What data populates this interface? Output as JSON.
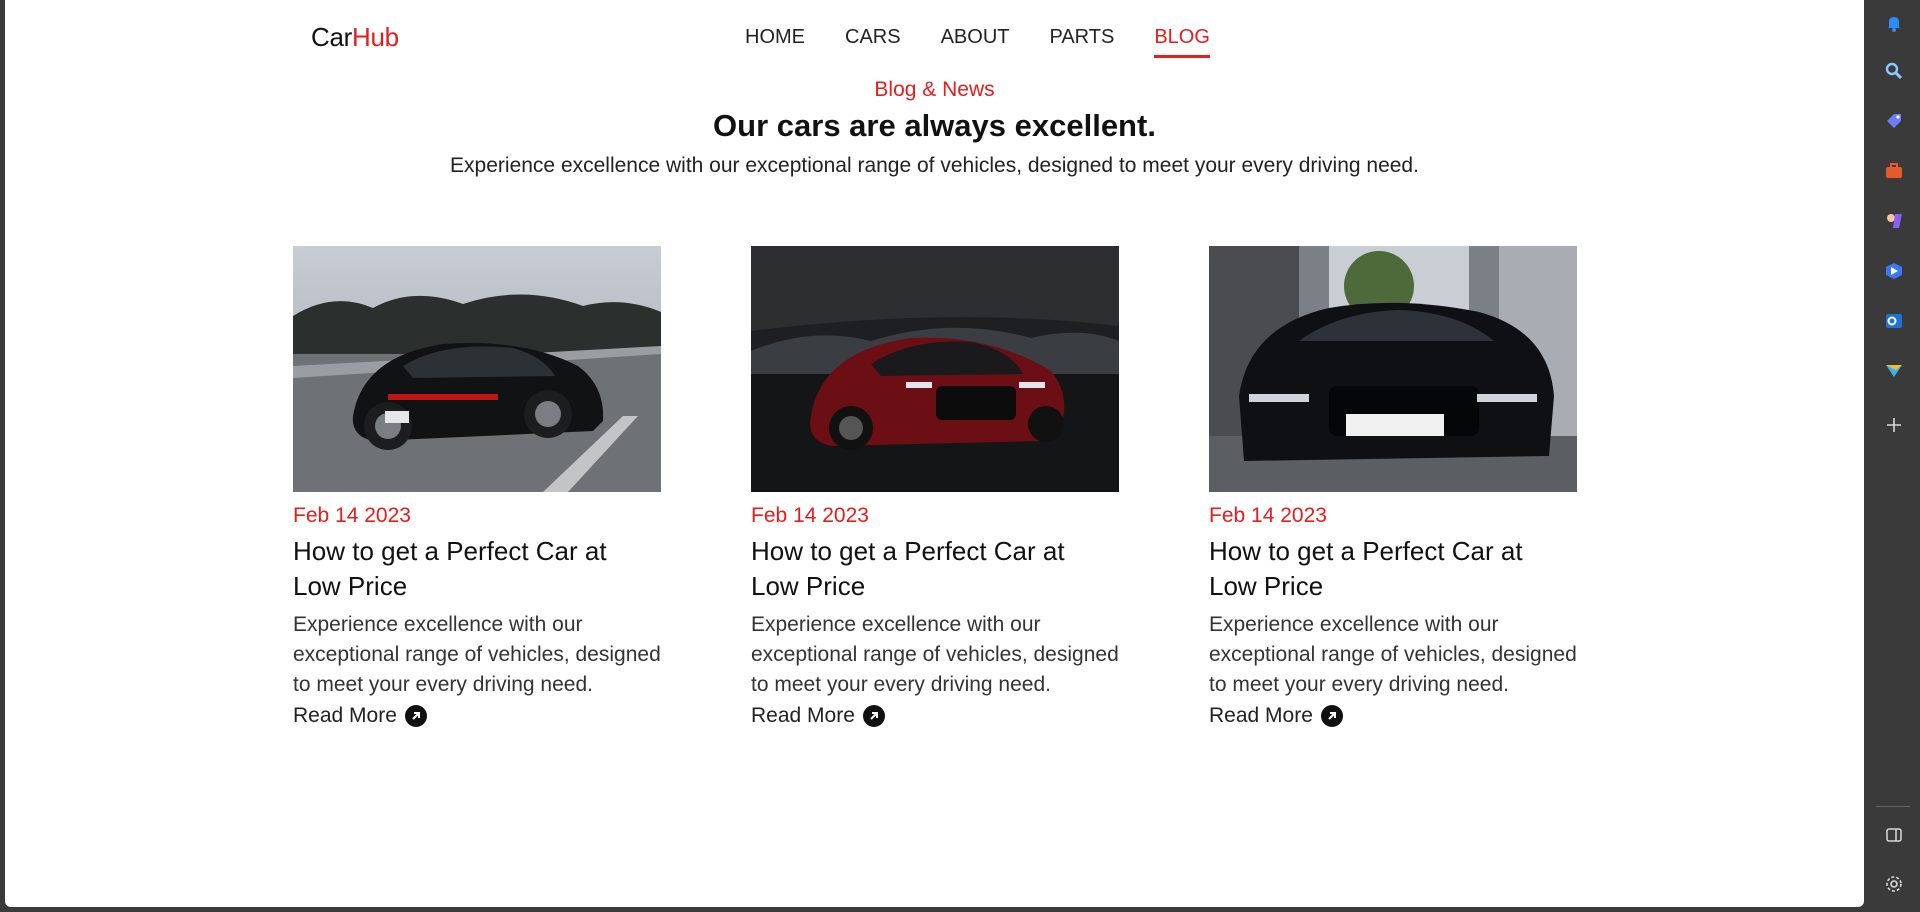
{
  "site": {
    "logo_car": "Car",
    "logo_hub": "Hub"
  },
  "nav": {
    "items": [
      {
        "label": "HOME",
        "active": false
      },
      {
        "label": "CARS",
        "active": false
      },
      {
        "label": "ABOUT",
        "active": false
      },
      {
        "label": "PARTS",
        "active": false
      },
      {
        "label": "BLOG",
        "active": true
      }
    ]
  },
  "section": {
    "kicker": "Blog & News",
    "headline": "Our cars are always excellent.",
    "subhead": "Experience excellence with our exceptional range of vehicles, designed to meet your every driving need."
  },
  "posts": [
    {
      "date": "Feb 14 2023",
      "title": "How to get a Perfect Car at Low Price",
      "excerpt": "Experience excellence with our exceptional range of vehicles, designed to meet your every driving need.",
      "read_more": "Read More"
    },
    {
      "date": "Feb 14 2023",
      "title": "How to get a Perfect Car at Low Price",
      "excerpt": "Experience excellence with our exceptional range of vehicles, designed to meet your every driving need.",
      "read_more": "Read More"
    },
    {
      "date": "Feb 14 2023",
      "title": "How to get a Perfect Car at Low Price",
      "excerpt": "Experience excellence with our exceptional range of vehicles, designed to meet your every driving need.",
      "read_more": "Read More"
    }
  ],
  "colors": {
    "accent": "#e51d1d",
    "sidebar": "#3a3a3a"
  },
  "sidebar_icons": [
    "bell-icon",
    "search-icon",
    "tag-icon",
    "toolbox-icon",
    "games-icon",
    "copilot-icon",
    "outlook-icon",
    "send-icon",
    "plus-icon",
    "split-screen-icon",
    "settings-icon"
  ]
}
